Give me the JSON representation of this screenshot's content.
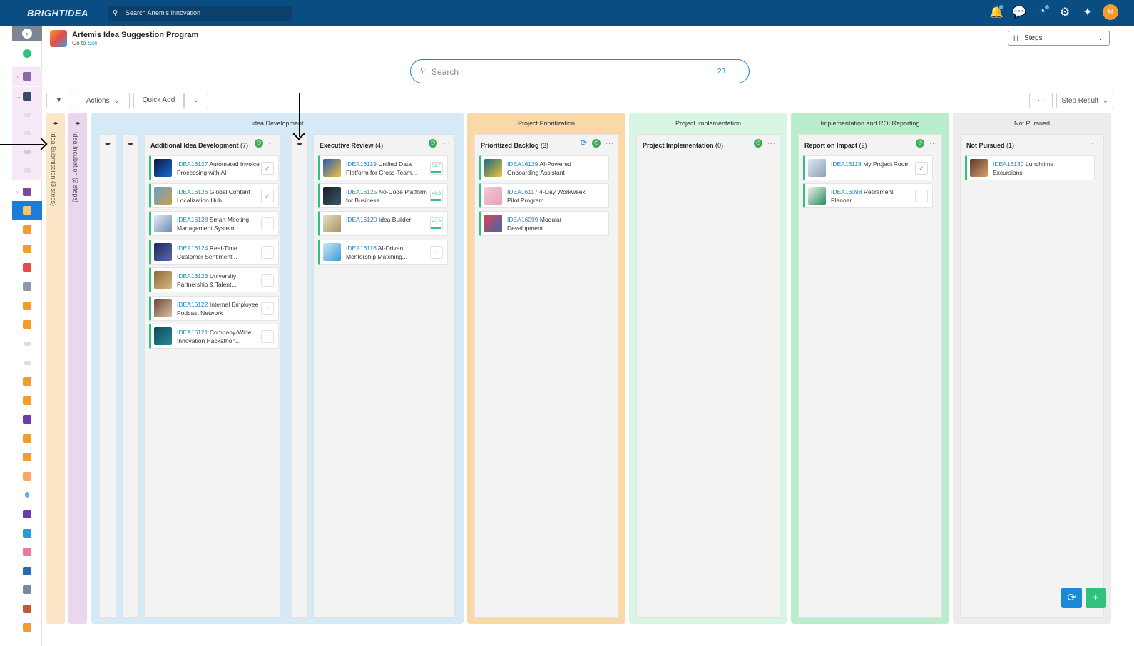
{
  "topbar": {
    "logo": "BRIGHTIDEA",
    "search_placeholder": "Search Artemis Innovation",
    "avatar_initial": "M"
  },
  "header": {
    "title": "Artemis Idea Suggestion Program",
    "goto_prefix": "Go to",
    "goto_link": "Site",
    "steps_label": "Steps"
  },
  "search": {
    "placeholder": "Search",
    "count": "23"
  },
  "toolbar": {
    "actions_label": "Actions",
    "quick_add_label": "Quick Add",
    "more_label": "···",
    "step_result_label": "Step Result"
  },
  "collapsed_steps": {
    "submission": "Idea Submission (3 steps)",
    "incubation": "Idea Incubation (2 steps)"
  },
  "groups": {
    "idea_development": {
      "title": "Idea Development",
      "lanes": {
        "additional": {
          "name": "Additional Idea Development",
          "count": "(7)",
          "cards": [
            {
              "id": "IDEA16127",
              "text": "Automated Invoice Processing with AI",
              "status": "✓"
            },
            {
              "id": "IDEA16126",
              "text": "Global Content Localization Hub",
              "status": "✓"
            },
            {
              "id": "IDEA16128",
              "text": "Smart Meeting Management System",
              "status": "-"
            },
            {
              "id": "IDEA16124",
              "text": "Real-Time Customer Sentiment...",
              "status": "-"
            },
            {
              "id": "IDEA16123",
              "text": "University Partnership & Talent...",
              "status": "-"
            },
            {
              "id": "IDEA16122",
              "text": "Internal Employee Podcast Network",
              "status": "-"
            },
            {
              "id": "IDEA16121",
              "text": "Company-Wide Innovation Hackathon...",
              "status": "-"
            }
          ]
        },
        "executive": {
          "name": "Executive Review",
          "count": "(4)",
          "cards": [
            {
              "id": "IDEA16119",
              "text": "Unified Data Platform for Cross-Team...",
              "score": "53.7"
            },
            {
              "id": "IDEA16125",
              "text": "No-Code Platform for Business...",
              "score": "43.9"
            },
            {
              "id": "IDEA16120",
              "text": "Idea Builder",
              "score": "43.9"
            },
            {
              "id": "IDEA16116",
              "text": "AI-Driven Mentorship Matching...",
              "score": "-"
            }
          ]
        }
      }
    },
    "prioritization": {
      "title": "Project Prioritization",
      "lane": {
        "name": "Prioritized Backlog",
        "count": "(3)",
        "cards": [
          {
            "id": "IDEA16129",
            "text": "AI-Powered Onboarding Assistant"
          },
          {
            "id": "IDEA16117",
            "text": "4-Day Workweek Pilot Program"
          },
          {
            "id": "IDEA16099",
            "text": "Modular Development"
          }
        ]
      }
    },
    "implementation": {
      "title": "Project Implementation",
      "lane": {
        "name": "Project Implementation",
        "count": "(0)"
      }
    },
    "roi": {
      "title": "Implementation and ROI Reporting",
      "lane": {
        "name": "Report on Impact",
        "count": "(2)",
        "cards": [
          {
            "id": "IDEA16118",
            "text": "My Project Room",
            "status": "✓"
          },
          {
            "id": "IDEA16098",
            "text": "Retirement Planner",
            "status": "-"
          }
        ]
      }
    },
    "not_pursued": {
      "title": "Not Pursued",
      "lane": {
        "name": "Not Pursued",
        "count": "(1)",
        "cards": [
          {
            "id": "IDEA16130",
            "text": "Lunchtime Excursions"
          }
        ]
      }
    }
  },
  "colors": {
    "topbar": "#0a4d82",
    "idea_development": "#d6e9f7",
    "prioritization": "#fbd8a8",
    "implementation": "#d9f5e4",
    "roi": "#b9edcb",
    "not_pursued": "#ececec",
    "submission_col": "#fbe7c7",
    "incubation_col": "#ead7ee",
    "card_border": "#2ec27e",
    "link": "#1a8ad8"
  }
}
